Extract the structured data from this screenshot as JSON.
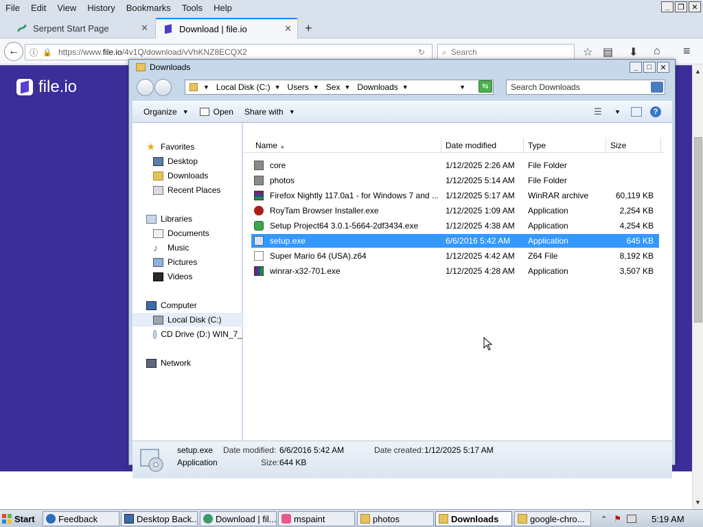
{
  "browser": {
    "menu": [
      "File",
      "Edit",
      "View",
      "History",
      "Bookmarks",
      "Tools",
      "Help"
    ],
    "tabs": [
      {
        "title": "Serpent Start Page",
        "active": false
      },
      {
        "title": "Download | file.io",
        "active": true
      }
    ],
    "url_prefix": "https://www.",
    "url_host": "file.io",
    "url_path": "/4v1Q/download/vVhKNZ8ECQX2",
    "search_placeholder": "Search"
  },
  "page": {
    "logo_text": "file.io",
    "brand_color": "#3b2e99"
  },
  "explorer": {
    "title": "Downloads",
    "breadcrumb": [
      "Local Disk (C:)",
      "Users",
      "Sex",
      "Downloads"
    ],
    "search_placeholder": "Search Downloads",
    "toolbar": {
      "organize": "Organize",
      "open": "Open",
      "share": "Share with"
    },
    "nav": {
      "favorites": "Favorites",
      "desktop": "Desktop",
      "downloads": "Downloads",
      "recent": "Recent Places",
      "libraries": "Libraries",
      "documents": "Documents",
      "music": "Music",
      "pictures": "Pictures",
      "videos": "Videos",
      "computer": "Computer",
      "local_disk": "Local Disk (C:)",
      "cd_drive": "CD Drive (D:) WIN_7_",
      "network": "Network"
    },
    "columns": {
      "name": "Name",
      "date": "Date modified",
      "type": "Type",
      "size": "Size"
    },
    "files": [
      {
        "name": "core",
        "date": "1/12/2025 2:26 AM",
        "type": "File Folder",
        "size": "",
        "icon": "folder-icon"
      },
      {
        "name": "photos",
        "date": "1/12/2025 5:14 AM",
        "type": "File Folder",
        "size": "",
        "icon": "folder-icon"
      },
      {
        "name": "Firefox Nightly 117.0a1 - for Windows 7 and ...",
        "date": "1/12/2025 5:17 AM",
        "type": "WinRAR archive",
        "size": "60,119 KB",
        "icon": "winrar-archive-icon"
      },
      {
        "name": "RoyTam Browser Installer.exe",
        "date": "1/12/2025 1:09 AM",
        "type": "Application",
        "size": "2,254 KB",
        "icon": "roytam-app-icon"
      },
      {
        "name": "Setup Project64 3.0.1-5664-2df3434.exe",
        "date": "1/12/2025 4:38 AM",
        "type": "Application",
        "size": "4,254 KB",
        "icon": "project64-setup-icon"
      },
      {
        "name": "setup.exe",
        "date": "6/6/2016 5:42 AM",
        "type": "Application",
        "size": "645 KB",
        "icon": "setup-app-icon"
      },
      {
        "name": "Super Mario 64 (USA).z64",
        "date": "1/12/2025 4:42 AM",
        "type": "Z64 File",
        "size": "8,192 KB",
        "icon": "blank-file-icon"
      },
      {
        "name": "winrar-x32-701.exe",
        "date": "1/12/2025 4:28 AM",
        "type": "Application",
        "size": "3,507 KB",
        "icon": "winrar-installer-icon"
      }
    ],
    "selected_index": 5,
    "details": {
      "name": "setup.exe",
      "type": "Application",
      "modified_label": "Date modified:",
      "modified": "6/6/2016 5:42 AM",
      "created_label": "Date created:",
      "created": "1/12/2025 5:17 AM",
      "size_label": "Size:",
      "size": "644 KB"
    }
  },
  "taskbar": {
    "start": "Start",
    "items": [
      {
        "label": "Feedback",
        "active": false
      },
      {
        "label": "Desktop Back...",
        "active": false
      },
      {
        "label": "Download | fil...",
        "active": false
      },
      {
        "label": "mspaint",
        "active": false
      },
      {
        "label": "photos",
        "active": false
      },
      {
        "label": "Downloads",
        "active": true
      },
      {
        "label": "google-chro...",
        "active": false
      }
    ],
    "clock": "5:19 AM"
  }
}
